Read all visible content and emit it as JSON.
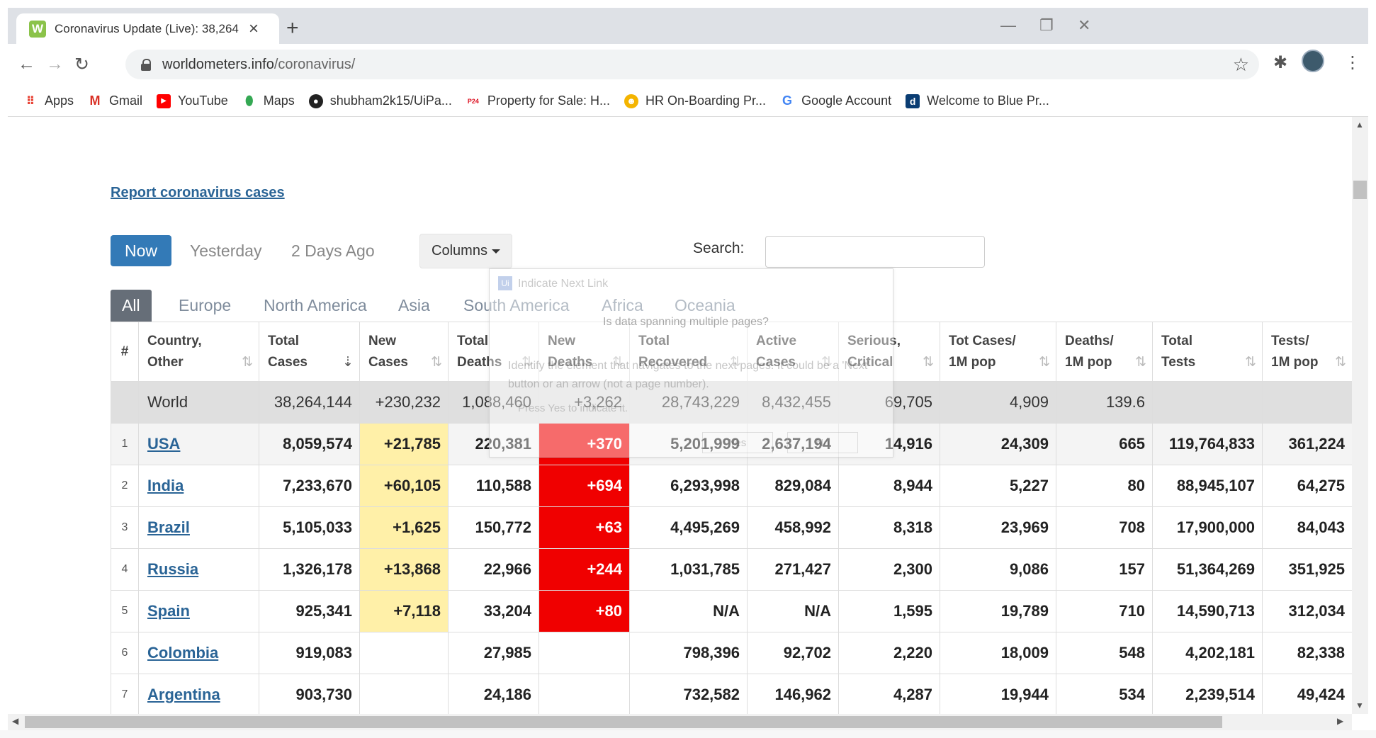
{
  "browser": {
    "tab_title": "Coronavirus Update (Live): 38,264,",
    "tab_favicon_letter": "W",
    "url_host": "worldometers.info",
    "url_path": "/coronavirus/",
    "bookmarks": [
      {
        "label": "Apps",
        "icon": "apps-grid-icon"
      },
      {
        "label": "Gmail",
        "icon": "gmail-icon"
      },
      {
        "label": "YouTube",
        "icon": "youtube-icon"
      },
      {
        "label": "Maps",
        "icon": "maps-pin-icon"
      },
      {
        "label": "shubham2k15/UiPa...",
        "icon": "github-icon"
      },
      {
        "label": "Property for Sale: H...",
        "icon": "p24-icon"
      },
      {
        "label": "HR On-Boarding Pr...",
        "icon": "hr-icon"
      },
      {
        "label": "Google Account",
        "icon": "google-icon"
      },
      {
        "label": "Welcome to Blue Pr...",
        "icon": "blueprism-icon"
      }
    ]
  },
  "page": {
    "report_link": "Report coronavirus cases",
    "day_tabs": [
      "Now",
      "Yesterday",
      "2 Days Ago"
    ],
    "columns_button": "Columns",
    "search_label": "Search:",
    "search_value": "",
    "region_tabs": [
      "All",
      "Europe",
      "North America",
      "Asia",
      "South America",
      "Africa",
      "Oceania"
    ]
  },
  "table": {
    "headers": [
      {
        "line1": "#",
        "line2": ""
      },
      {
        "line1": "Country,",
        "line2": "Other"
      },
      {
        "line1": "Total",
        "line2": "Cases"
      },
      {
        "line1": "New",
        "line2": "Cases"
      },
      {
        "line1": "Total",
        "line2": "Deaths"
      },
      {
        "line1": "New",
        "line2": "Deaths"
      },
      {
        "line1": "Total",
        "line2": "Recovered"
      },
      {
        "line1": "Active",
        "line2": "Cases"
      },
      {
        "line1": "Serious,",
        "line2": "Critical"
      },
      {
        "line1": "Tot Cases/",
        "line2": "1M pop"
      },
      {
        "line1": "Deaths/",
        "line2": "1M pop"
      },
      {
        "line1": "Total",
        "line2": "Tests"
      },
      {
        "line1": "Tests/",
        "line2": "1M pop"
      }
    ],
    "world": {
      "country": "World",
      "total_cases": "38,264,144",
      "new_cases": "+230,232",
      "total_deaths": "1,088,460",
      "new_deaths": "+3,262",
      "total_recovered": "28,743,229",
      "active_cases": "8,432,455",
      "serious": "69,705",
      "cases_per_m": "4,909",
      "deaths_per_m": "139.6",
      "total_tests": "",
      "tests_per_m": ""
    },
    "rows": [
      {
        "rank": "1",
        "country": "USA",
        "total_cases": "8,059,574",
        "new_cases": "+21,785",
        "total_deaths": "220,381",
        "new_deaths": "+370",
        "total_recovered": "5,201,999",
        "active_cases": "2,637,194",
        "serious": "14,916",
        "cases_per_m": "24,309",
        "deaths_per_m": "665",
        "total_tests": "119,764,833",
        "tests_per_m": "361,224"
      },
      {
        "rank": "2",
        "country": "India",
        "total_cases": "7,233,670",
        "new_cases": "+60,105",
        "total_deaths": "110,588",
        "new_deaths": "+694",
        "total_recovered": "6,293,998",
        "active_cases": "829,084",
        "serious": "8,944",
        "cases_per_m": "5,227",
        "deaths_per_m": "80",
        "total_tests": "88,945,107",
        "tests_per_m": "64,275"
      },
      {
        "rank": "3",
        "country": "Brazil",
        "total_cases": "5,105,033",
        "new_cases": "+1,625",
        "total_deaths": "150,772",
        "new_deaths": "+63",
        "total_recovered": "4,495,269",
        "active_cases": "458,992",
        "serious": "8,318",
        "cases_per_m": "23,969",
        "deaths_per_m": "708",
        "total_tests": "17,900,000",
        "tests_per_m": "84,043"
      },
      {
        "rank": "4",
        "country": "Russia",
        "total_cases": "1,326,178",
        "new_cases": "+13,868",
        "total_deaths": "22,966",
        "new_deaths": "+244",
        "total_recovered": "1,031,785",
        "active_cases": "271,427",
        "serious": "2,300",
        "cases_per_m": "9,086",
        "deaths_per_m": "157",
        "total_tests": "51,364,269",
        "tests_per_m": "351,925"
      },
      {
        "rank": "5",
        "country": "Spain",
        "total_cases": "925,341",
        "new_cases": "+7,118",
        "total_deaths": "33,204",
        "new_deaths": "+80",
        "total_recovered": "N/A",
        "active_cases": "N/A",
        "serious": "1,595",
        "cases_per_m": "19,789",
        "deaths_per_m": "710",
        "total_tests": "14,590,713",
        "tests_per_m": "312,034"
      },
      {
        "rank": "6",
        "country": "Colombia",
        "total_cases": "919,083",
        "new_cases": "",
        "total_deaths": "27,985",
        "new_deaths": "",
        "total_recovered": "798,396",
        "active_cases": "92,702",
        "serious": "2,220",
        "cases_per_m": "18,009",
        "deaths_per_m": "548",
        "total_tests": "4,202,181",
        "tests_per_m": "82,338"
      },
      {
        "rank": "7",
        "country": "Argentina",
        "total_cases": "903,730",
        "new_cases": "",
        "total_deaths": "24,186",
        "new_deaths": "",
        "total_recovered": "732,582",
        "active_cases": "146,962",
        "serious": "4,287",
        "cases_per_m": "19,944",
        "deaths_per_m": "534",
        "total_tests": "2,239,514",
        "tests_per_m": "49,424"
      }
    ]
  },
  "overlay": {
    "title": "Indicate Next Link",
    "question": "Is data spanning multiple pages?",
    "description": "Identify the element that navigates to the next pages. It could be a 'Next' button or an arrow (not a page number).",
    "hint": "Press Yes to indicate it.",
    "yes": "Yes",
    "no": "No"
  },
  "colors": {
    "accent": "#337ab7",
    "link": "#2a6496",
    "new_cases_bg": "#fff0a8",
    "new_deaths_bg": "#f00000",
    "world_row_bg": "#dfdfdf"
  }
}
